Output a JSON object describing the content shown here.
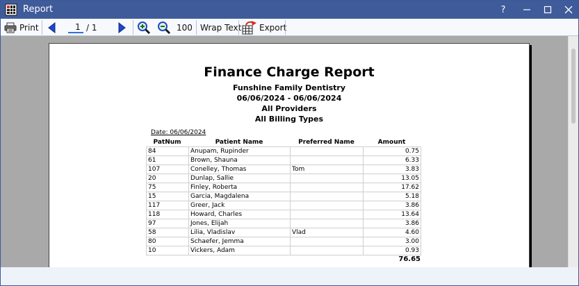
{
  "window": {
    "title": "Report"
  },
  "title_buttons": {
    "help": "?"
  },
  "toolbar": {
    "print": "Print",
    "page_current": "1",
    "page_of": "/ 1",
    "zoom_level": "100",
    "wrap_text": "Wrap Text",
    "export": "Export"
  },
  "report": {
    "title": "Finance Charge Report",
    "practice": "Funshine Family Dentistry",
    "date_range": "06/06/2024 - 06/06/2024",
    "providers": "All Providers",
    "billing_types": "All Billing Types",
    "date_header": "Date: 06/06/2024",
    "columns": [
      "PatNum",
      "Patient Name",
      "Preferred Name",
      "Amount"
    ],
    "rows": [
      [
        "84",
        "Anupam, Rupinder",
        "",
        "0.75"
      ],
      [
        "61",
        "Brown, Shauna",
        "",
        "6.33"
      ],
      [
        "107",
        "Conelley, Thomas",
        "Tom",
        "3.83"
      ],
      [
        "20",
        "Dunlap, Sallie",
        "",
        "13.05"
      ],
      [
        "75",
        "Finley, Roberta",
        "",
        "17.62"
      ],
      [
        "15",
        "Garcia, Magdalena",
        "",
        "5.18"
      ],
      [
        "117",
        "Greer, Jack",
        "",
        "3.86"
      ],
      [
        "118",
        "Howard, Charles",
        "",
        "13.64"
      ],
      [
        "97",
        "Jones, Elijah",
        "",
        "3.86"
      ],
      [
        "58",
        "Lilia, Vladislav",
        "Vlad",
        "4.60"
      ],
      [
        "80",
        "Schaefer, Jemma",
        "",
        "3.00"
      ],
      [
        "10",
        "Vickers, Adam",
        "",
        "0.93"
      ]
    ],
    "total": "76.65"
  },
  "colors": {
    "titlebar": "#3f5b9a",
    "accent": "#2f6fd6"
  }
}
